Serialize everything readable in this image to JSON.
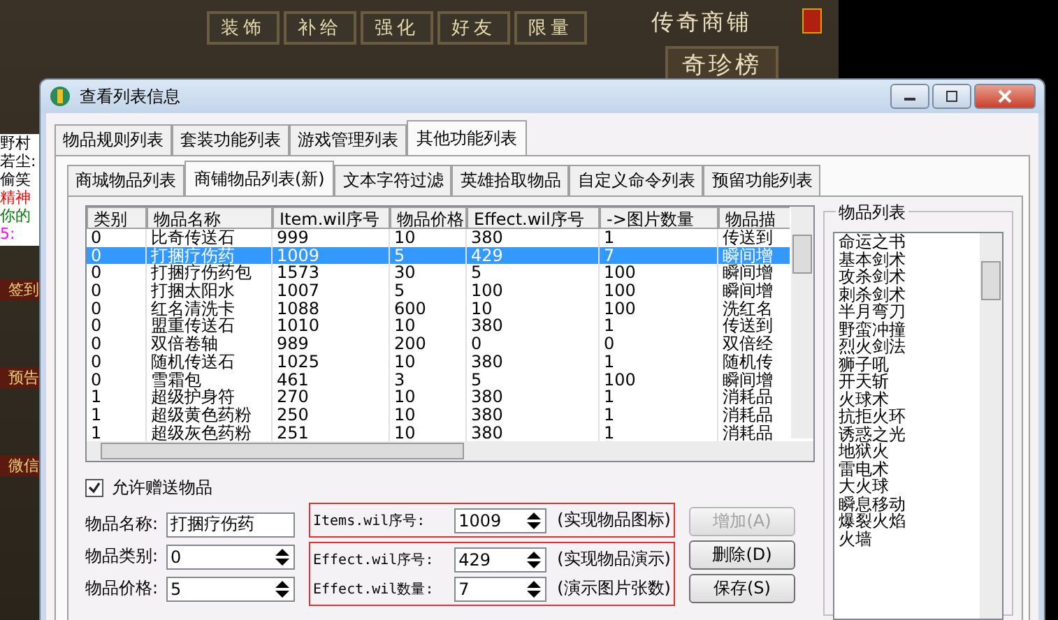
{
  "game": {
    "tabs": [
      "装饰",
      "补给",
      "强化",
      "好友",
      "限量"
    ],
    "shop_title": "传奇商铺",
    "ranking": "奇珍榜",
    "chat": [
      {
        "text": "野村",
        "color": "#000000"
      },
      {
        "text": "若尘:",
        "color": "#000000"
      },
      {
        "text": "偷笑",
        "color": "#000000"
      },
      {
        "text": "精神",
        "color": "#ff0000"
      },
      {
        "text": "你的",
        "color": "#007700"
      },
      {
        "text": "5:",
        "color": "#ff00ff"
      }
    ],
    "side_buttons": [
      "签到",
      "预告",
      "微信"
    ]
  },
  "window": {
    "title": "查看列表信息"
  },
  "tabs": [
    {
      "label": "物品规则列表",
      "selected": false
    },
    {
      "label": "套装功能列表",
      "selected": false
    },
    {
      "label": "游戏管理列表",
      "selected": false
    },
    {
      "label": "其他功能列表",
      "selected": true
    }
  ],
  "subtabs": [
    {
      "label": "商城物品列表",
      "selected": false
    },
    {
      "label": "商铺物品列表(新)",
      "selected": true
    },
    {
      "label": "文本字符过滤",
      "selected": false
    },
    {
      "label": "英雄拾取物品",
      "selected": false
    },
    {
      "label": "自定义命令列表",
      "selected": false
    },
    {
      "label": "预留功能列表",
      "selected": false
    }
  ],
  "table": {
    "columns": [
      "类别",
      "物品名称",
      "Item.wil序号",
      "物品价格",
      "Effect.wil序号",
      "->图片数量",
      "物品描"
    ],
    "rows": [
      {
        "cells": [
          "0",
          "比奇传送石",
          "999",
          "10",
          "380",
          "1",
          "传送到"
        ],
        "selected": false
      },
      {
        "cells": [
          "0",
          "打捆疗伤药",
          "1009",
          "5",
          "429",
          "7",
          "瞬间增"
        ],
        "selected": true
      },
      {
        "cells": [
          "0",
          "打捆疗伤药包",
          "1573",
          "30",
          "5",
          "100",
          "瞬间增"
        ],
        "selected": false
      },
      {
        "cells": [
          "0",
          "打捆太阳水",
          "1007",
          "5",
          "100",
          "100",
          "瞬间增"
        ],
        "selected": false
      },
      {
        "cells": [
          "0",
          "红名清洗卡",
          "1088",
          "600",
          "10",
          "100",
          "洗红名"
        ],
        "selected": false
      },
      {
        "cells": [
          "0",
          "盟重传送石",
          "1010",
          "10",
          "380",
          "1",
          "传送到"
        ],
        "selected": false
      },
      {
        "cells": [
          "0",
          "双倍卷轴",
          "989",
          "200",
          "0",
          "0",
          "双倍经"
        ],
        "selected": false
      },
      {
        "cells": [
          "0",
          "随机传送石",
          "1025",
          "10",
          "380",
          "1",
          "随机传"
        ],
        "selected": false
      },
      {
        "cells": [
          "0",
          "雪霜包",
          "461",
          "3",
          "5",
          "100",
          "瞬间增"
        ],
        "selected": false
      },
      {
        "cells": [
          "1",
          "超级护身符",
          "270",
          "10",
          "380",
          "1",
          "消耗品"
        ],
        "selected": false
      },
      {
        "cells": [
          "1",
          "超级黄色药粉",
          "250",
          "10",
          "380",
          "1",
          "消耗品"
        ],
        "selected": false
      },
      {
        "cells": [
          "1",
          "超级灰色药粉",
          "251",
          "10",
          "380",
          "1",
          "消耗品"
        ],
        "selected": false
      }
    ]
  },
  "allow_gift": {
    "label": "允许赠送物品",
    "checked": true
  },
  "form": [
    {
      "label": "物品名称:",
      "value": "打捆疗伤药",
      "kind": "text"
    },
    {
      "label": "物品类别:",
      "value": "0",
      "kind": "spin"
    },
    {
      "label": "物品价格:",
      "value": "5",
      "kind": "spin"
    }
  ],
  "wil_groups": [
    [
      {
        "label": "Items.wil序号:",
        "value": "1009",
        "note": "(实现物品图标)"
      }
    ],
    [
      {
        "label": "Effect.wil序号:",
        "value": "429",
        "note": "(实现物品演示)"
      },
      {
        "label": "Effect.wil数量:",
        "value": "7",
        "note": "(演示图片张数)"
      }
    ]
  ],
  "buttons": [
    {
      "label": "增加(A)",
      "disabled": true
    },
    {
      "label": "删除(D)",
      "disabled": false
    },
    {
      "label": "保存(S)",
      "disabled": false
    }
  ],
  "item_list": {
    "title": "物品列表",
    "items": [
      "命运之书",
      "基本剑术",
      "攻杀剑术",
      "刺杀剑术",
      "半月弯刀",
      "野蛮冲撞",
      "烈火剑法",
      "狮子吼",
      "开天斩",
      "火球术",
      "抗拒火环",
      "诱惑之光",
      "地狱火",
      "雷电术",
      "大火球",
      "瞬息移动",
      "爆裂火焰",
      "火墙"
    ]
  }
}
